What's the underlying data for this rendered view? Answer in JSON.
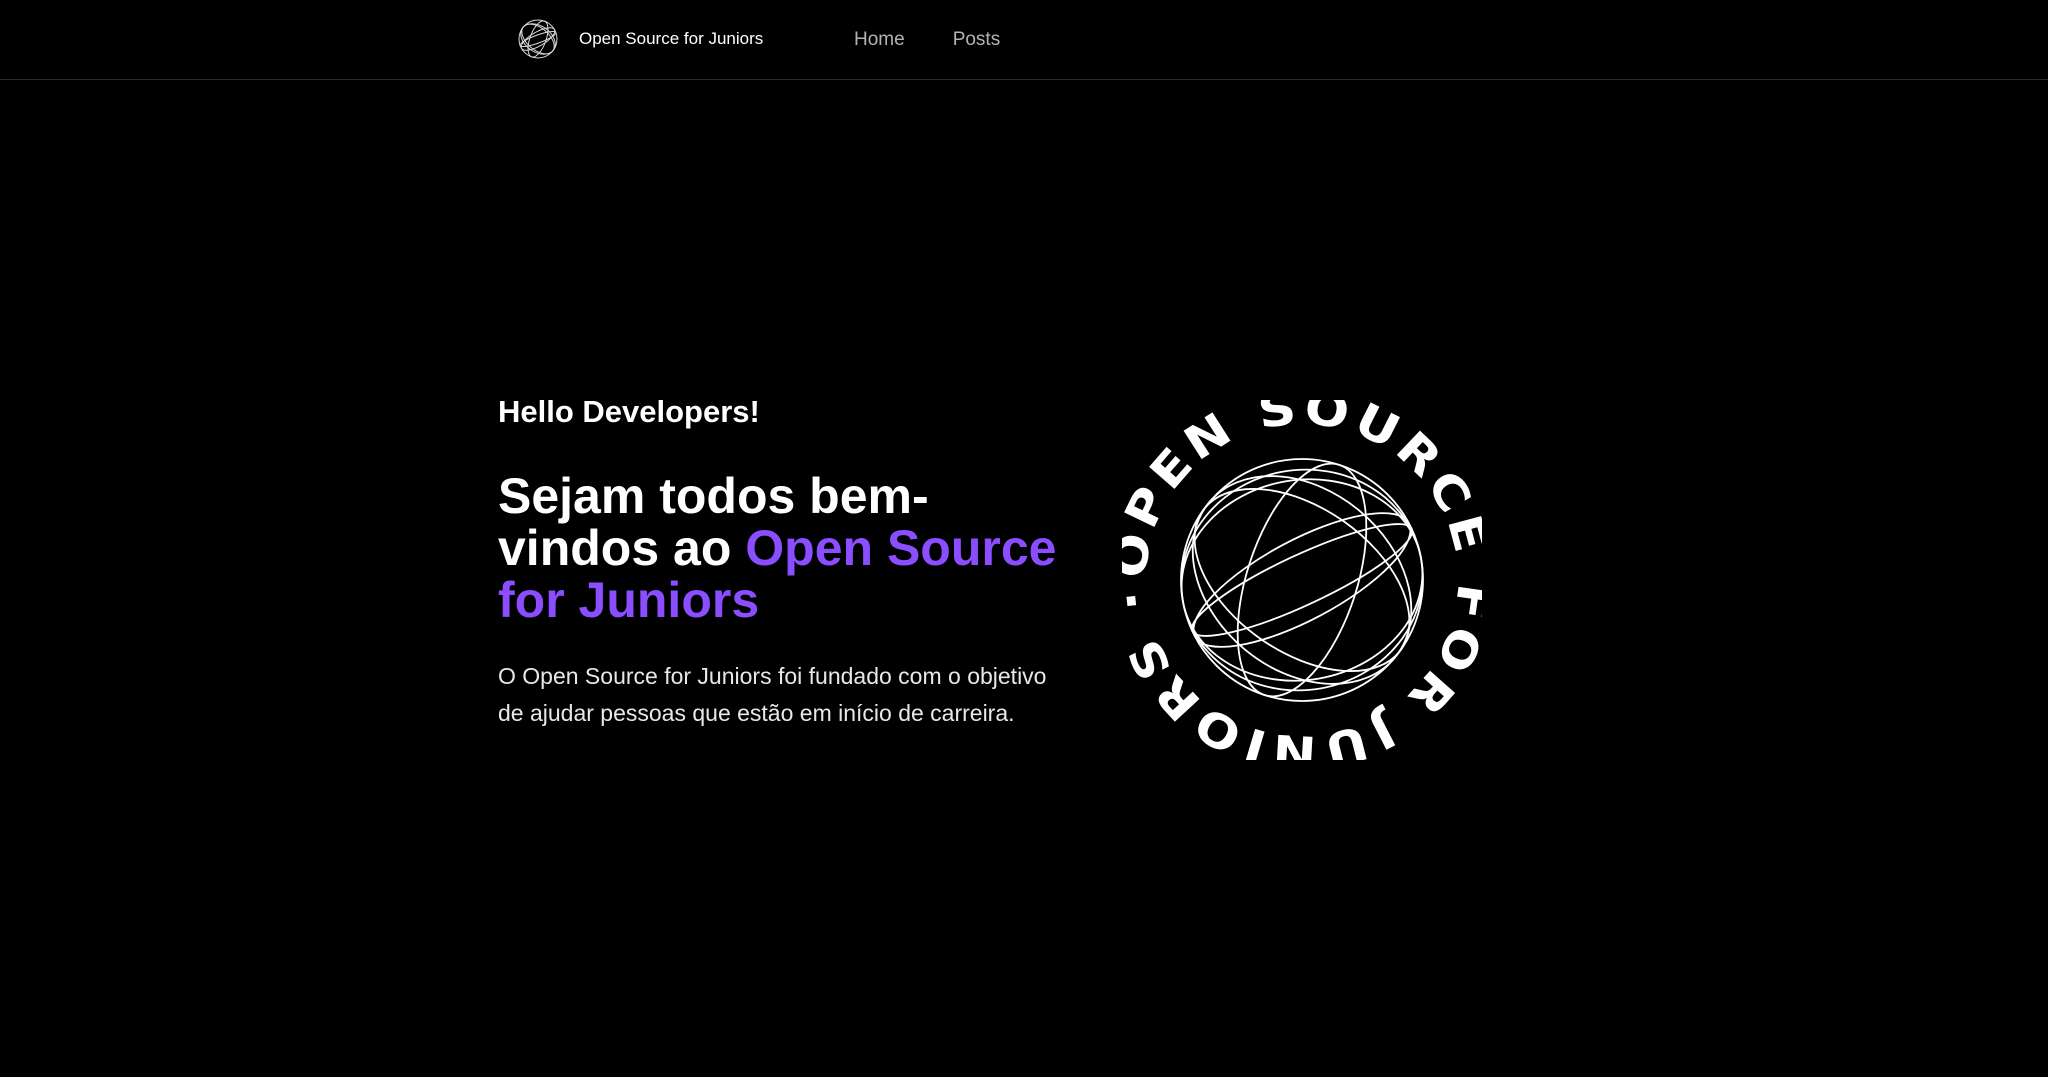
{
  "header": {
    "brand_name": "Open Source for Juniors",
    "logo_icon": "globe-wireframe-icon",
    "nav": [
      {
        "label": "Home"
      },
      {
        "label": "Posts"
      }
    ]
  },
  "hero": {
    "greeting": "Hello Developers!",
    "headline_prefix": "Sejam todos bem-vindos ao ",
    "headline_accent": "Open Source for Juniors",
    "description": "O Open Source for Juniors foi fundado com o objetivo de ajudar pessoas que estão em início de carreira."
  },
  "badge": {
    "ring_text": "OPEN SOURCE FOR JUNIORS ·",
    "icon": "globe-wireframe-icon"
  },
  "colors": {
    "background": "#000000",
    "text": "#ffffff",
    "accent": "#8a4dff",
    "nav_link": "#b3b3b3"
  }
}
